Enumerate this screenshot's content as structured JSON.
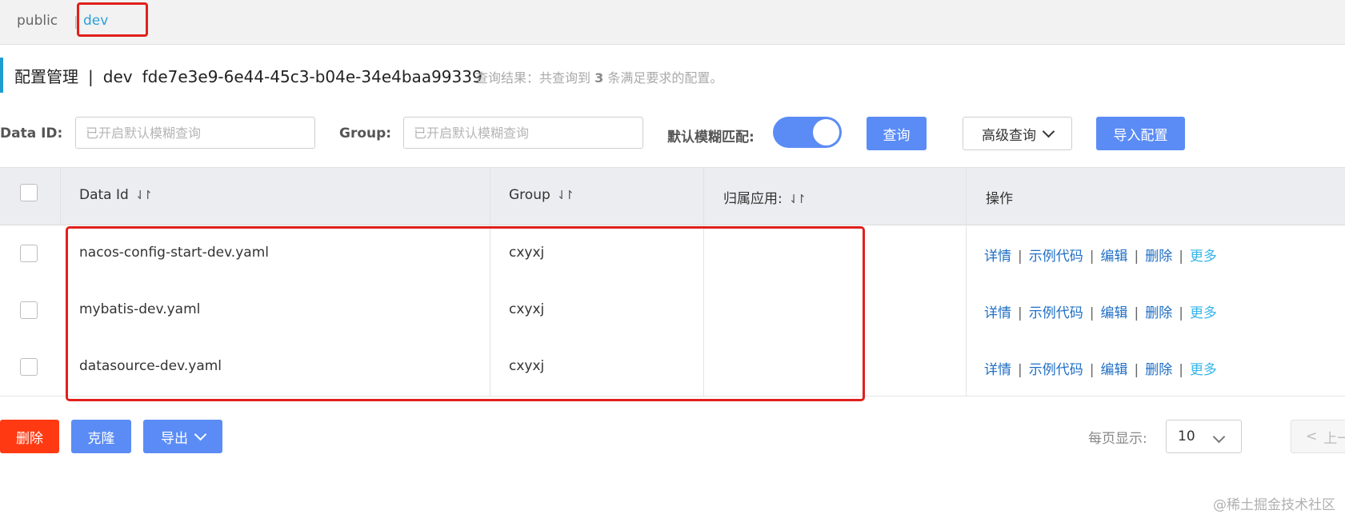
{
  "namespaces": {
    "public": "public",
    "separator": "|",
    "dev": "dev"
  },
  "title": {
    "main": "配置管理",
    "sep": "|",
    "ns_name": "dev",
    "ns_id": "fde7e3e9-6e44-45c3-b04e-34e4baa99339"
  },
  "query_result": {
    "prefix": "查询结果：共查询到",
    "count": "3",
    "suffix": "条满足要求的配置。"
  },
  "search": {
    "data_id_label": "Data ID:",
    "data_id_placeholder": "已开启默认模糊查询",
    "group_label": "Group:",
    "group_placeholder": "已开启默认模糊查询",
    "fuzzy_label": "默认模糊匹配:",
    "fuzzy_on": true,
    "query_button": "查询",
    "advanced_button": "高级查询",
    "import_button": "导入配置"
  },
  "table": {
    "headers": {
      "data_id": "Data Id",
      "group": "Group",
      "app": "归属应用:",
      "ops": "操作"
    },
    "sort_icon": "⇃↾",
    "rows": [
      {
        "data_id": "nacos-config-start-dev.yaml",
        "group": "cxyxj",
        "app": ""
      },
      {
        "data_id": "mybatis-dev.yaml",
        "group": "cxyxj",
        "app": ""
      },
      {
        "data_id": "datasource-dev.yaml",
        "group": "cxyxj",
        "app": ""
      }
    ],
    "ops": {
      "detail": "详情",
      "sample": "示例代码",
      "edit": "编辑",
      "delete": "删除",
      "more": "更多",
      "sep": "|"
    }
  },
  "footer": {
    "delete_button": "删除",
    "clone_button": "克隆",
    "export_button": "导出",
    "page_size_label": "每页显示:",
    "page_size_value": "10",
    "prev_button": "上一"
  },
  "watermark": "@稀土掘金技术社区",
  "colors": {
    "primary": "#5b8cf5",
    "danger": "#ff3a12",
    "link": "#1f6fc5",
    "highlight": "#e0201c",
    "accent_bar": "#1f9dd1"
  }
}
